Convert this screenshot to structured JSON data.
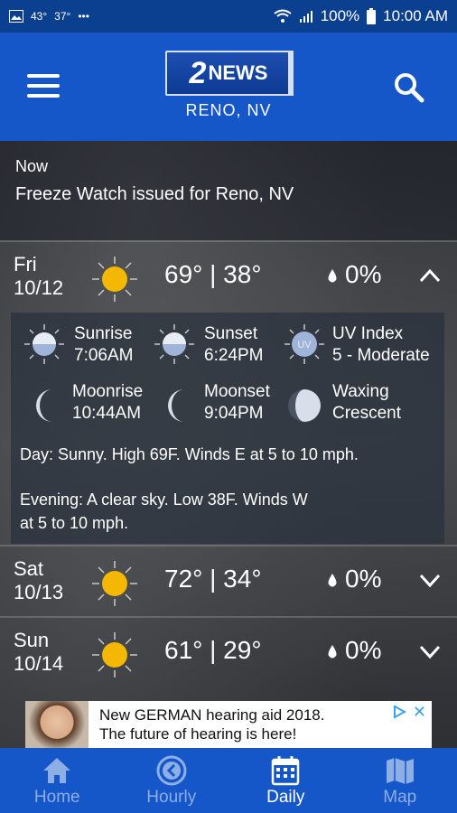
{
  "status_bar": {
    "temp1": "43°",
    "temp2": "37°",
    "dots": "•••",
    "battery": "100%",
    "time": "10:00 AM"
  },
  "header": {
    "logo_number": "2",
    "logo_word": "NEWS",
    "location": "RENO, NV"
  },
  "alert": {
    "when": "Now",
    "text": "Freeze Watch issued for Reno, NV"
  },
  "days": [
    {
      "dow": "Fri",
      "date": "10/12",
      "temps": "69° | 38°",
      "precip": "0%",
      "expanded": true
    },
    {
      "dow": "Sat",
      "date": "10/13",
      "temps": "72° | 34°",
      "precip": "0%",
      "expanded": false
    },
    {
      "dow": "Sun",
      "date": "10/14",
      "temps": "61° | 29°",
      "precip": "0%",
      "expanded": false
    }
  ],
  "details": {
    "sunrise_label": "Sunrise",
    "sunrise_time": "7:06AM",
    "sunset_label": "Sunset",
    "sunset_time": "6:24PM",
    "uv_label": "UV Index",
    "uv_value": "5 - Moderate",
    "uv_icon_text": "UV",
    "moonrise_label": "Moonrise",
    "moonrise_time": "10:44AM",
    "moonset_label": "Moonset",
    "moonset_time": "9:04PM",
    "phase_line1": "Waxing",
    "phase_line2": "Crescent",
    "day_desc": "Day: Sunny. High 69F. Winds E at 5 to 10 mph.",
    "evening_line1": "Evening: A clear sky. Low 38F. Winds W",
    "evening_line2": "at 5 to 10 mph."
  },
  "ad": {
    "line1": "New GERMAN hearing aid 2018.",
    "line2": "The future of hearing is here!",
    "close": "✕"
  },
  "nav": {
    "home": "Home",
    "hourly": "Hourly",
    "daily": "Daily",
    "map": "Map"
  },
  "colors": {
    "appbar": "#1557c9",
    "statusbar": "#0b3f8f",
    "sun": "#f5b800",
    "nav_inactive": "#8eaee6"
  }
}
